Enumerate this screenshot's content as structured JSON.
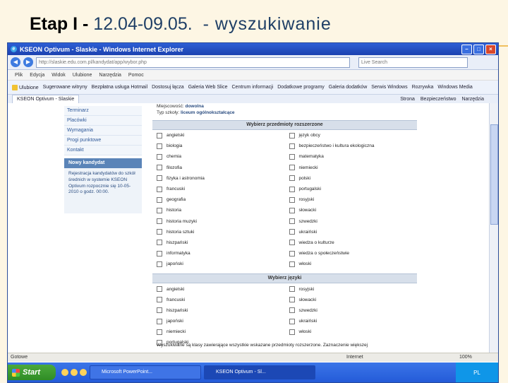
{
  "slide": {
    "title_prefix": "Etap I -",
    "title_dates": "12.04-09.05.",
    "title_word": "- wyszukiwanie"
  },
  "browser": {
    "window_title": "KSEON Optivum - Slaskie - Windows Internet Explorer",
    "address": "http://slaskie.edu.com.pl/kandydat/app/wybor.php",
    "search_placeholder": "Live Search",
    "menu": [
      "Plik",
      "Edycja",
      "Widok",
      "Ulubione",
      "Narzędzia",
      "Pomoc"
    ],
    "favorites_label": "Ulubione",
    "favorites": [
      "Sugerowane witryny",
      "Bezpłatna usługa Hotmail",
      "Dostosuj łącza",
      "Galeria Web Slice",
      "Centrum informacji",
      "Dodatkowe programy",
      "Galeria dodatków",
      "Serwis Windows",
      "Rozrywka",
      "Windows Media"
    ],
    "tab": "KSEON Optivum - Slaskie",
    "tab_tools": [
      "Strona",
      "Bezpieczeństwo",
      "Narzędzia"
    ],
    "status_left": "Gotowe",
    "status_zone": "Internet",
    "status_zoom": "100%"
  },
  "sidebar": {
    "items": [
      "Terminarz",
      "Placówki",
      "Wymagania",
      "Progi punktowe",
      "Kontakt"
    ],
    "new_candidate_title": "Nowy kandydat",
    "new_candidate_text": "Rejestracja kandydatów do szkół średnich w systemie KSEON Optivum rozpocznie się 10-05-2010 o godz. 00:00."
  },
  "main": {
    "meta_label_1": "Miejscowość:",
    "meta_value_1": "dowolna",
    "meta_label_2": "Typ szkoły:",
    "meta_value_2": "liceum ogólnokształcące",
    "section_subjects": "Wybierz przedmioty rozszerzone",
    "subjects": [
      "angielski",
      "język obcy",
      "biologia",
      "bezpieczeństwo i kultura ekologiczna",
      "chemia",
      "matematyka",
      "filozofia",
      "niemiecki",
      "fizyka i astronomia",
      "polski",
      "francuski",
      "portugalski",
      "geografia",
      "rosyjski",
      "historia",
      "słowacki",
      "historia muzyki",
      "szwedzki",
      "historia sztuki",
      "ukraiński",
      "hiszpański",
      "wiedza o kulturze",
      "informatyka",
      "wiedza o społeczeństwie",
      "japoński",
      "włoski"
    ],
    "section_languages": "Wybierz języki",
    "languages": [
      "angielski",
      "rosyjski",
      "francuski",
      "słowacki",
      "hiszpański",
      "szwedzki",
      "japoński",
      "ukraiński",
      "niemiecki",
      "włoski",
      "portugalski",
      ""
    ],
    "footnote": "Wyszukiwane są klasy zawierające wszystkie wskazane przedmioty rozszerzone. Zaznaczenie większej"
  },
  "taskbar": {
    "start": "Start",
    "tasks": [
      "Microsoft PowerPoint...",
      "KSEON Optivum - Sl..."
    ],
    "tray_lang": "PL"
  }
}
